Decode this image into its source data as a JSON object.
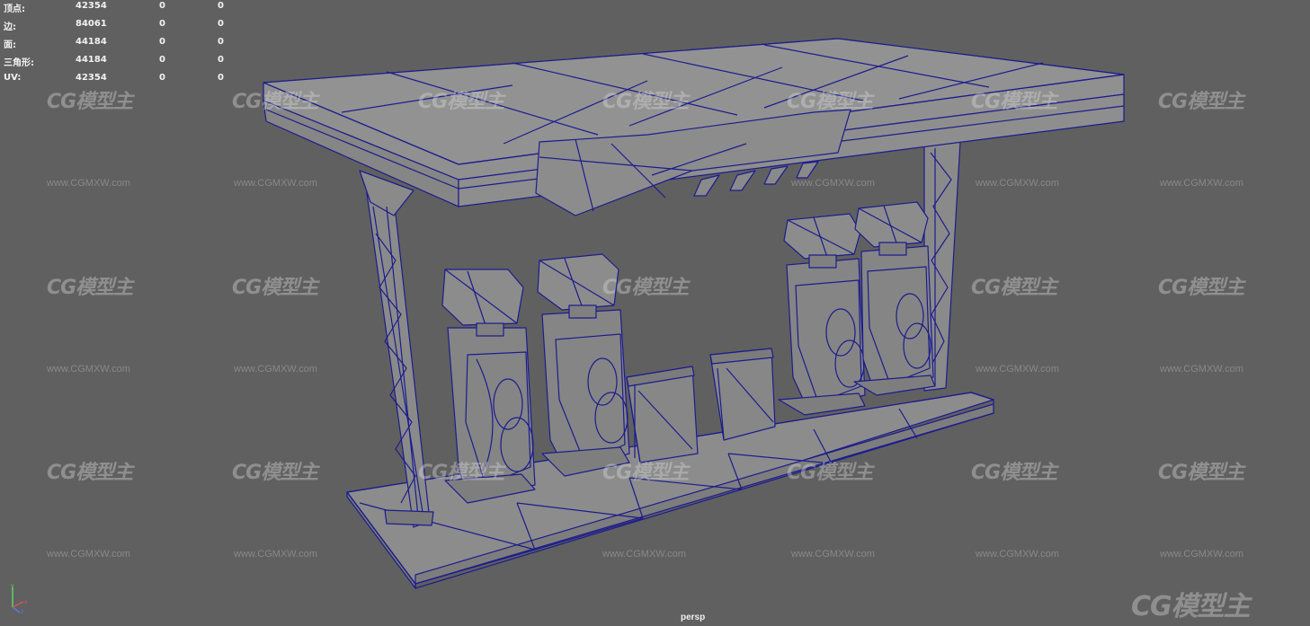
{
  "hud": {
    "rows": [
      {
        "label": "顶点:",
        "v1": "42354",
        "v2": "0",
        "v3": "0"
      },
      {
        "label": "边:",
        "v1": "84061",
        "v2": "0",
        "v3": "0"
      },
      {
        "label": "面:",
        "v1": "44184",
        "v2": "0",
        "v3": "0"
      },
      {
        "label": "三角形:",
        "v1": "44184",
        "v2": "0",
        "v3": "0"
      },
      {
        "label": "UV:",
        "v1": "42354",
        "v2": "0",
        "v3": "0"
      }
    ]
  },
  "viewport": {
    "camera": "persp",
    "background_color": "#606060",
    "wireframe_color": "#1a1a8c",
    "mesh_color": "#8a8a8a"
  },
  "watermark": {
    "logo_text": "CG模型主",
    "url_text": "www.CGMXW.com"
  },
  "axis_gizmo": {
    "x_label": "x",
    "y_label": "y",
    "z_label": "z"
  }
}
